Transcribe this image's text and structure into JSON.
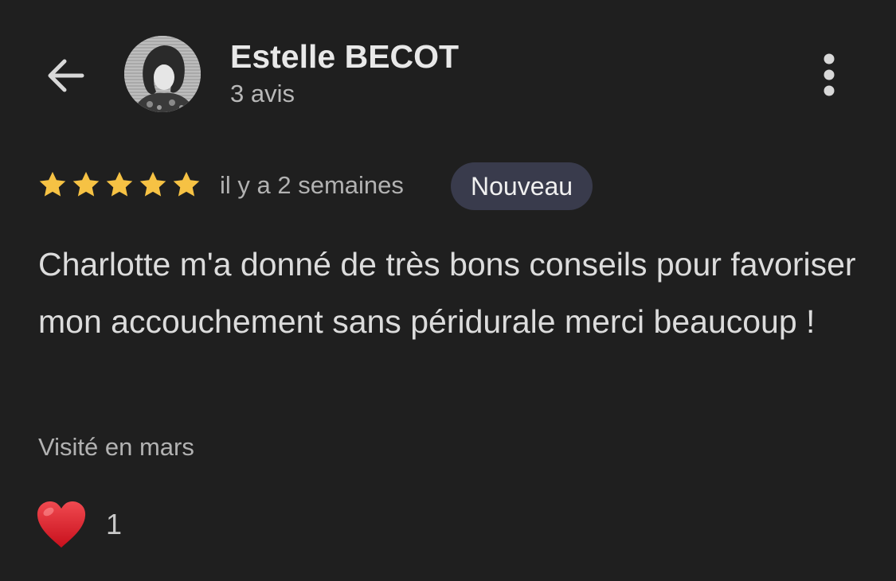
{
  "header": {
    "back_icon": "arrow-back-icon",
    "author_name": "Estelle BECOT",
    "review_count": "3 avis",
    "more_icon": "more-vertical-icon"
  },
  "review": {
    "rating": 5,
    "rating_max": 5,
    "date": "il y a 2 semaines",
    "badge": "Nouveau",
    "text": "Charlotte m'a donné de très bons conseils pour favoriser mon accouchement sans péridurale merci beaucoup !",
    "visit": "Visité en mars",
    "reaction_icon": "heart-icon",
    "reaction_count": "1"
  },
  "colors": {
    "background": "#1f1f1f",
    "star": "#f6c244",
    "badge_bg": "#393b4c",
    "heart": "#e2202c"
  }
}
